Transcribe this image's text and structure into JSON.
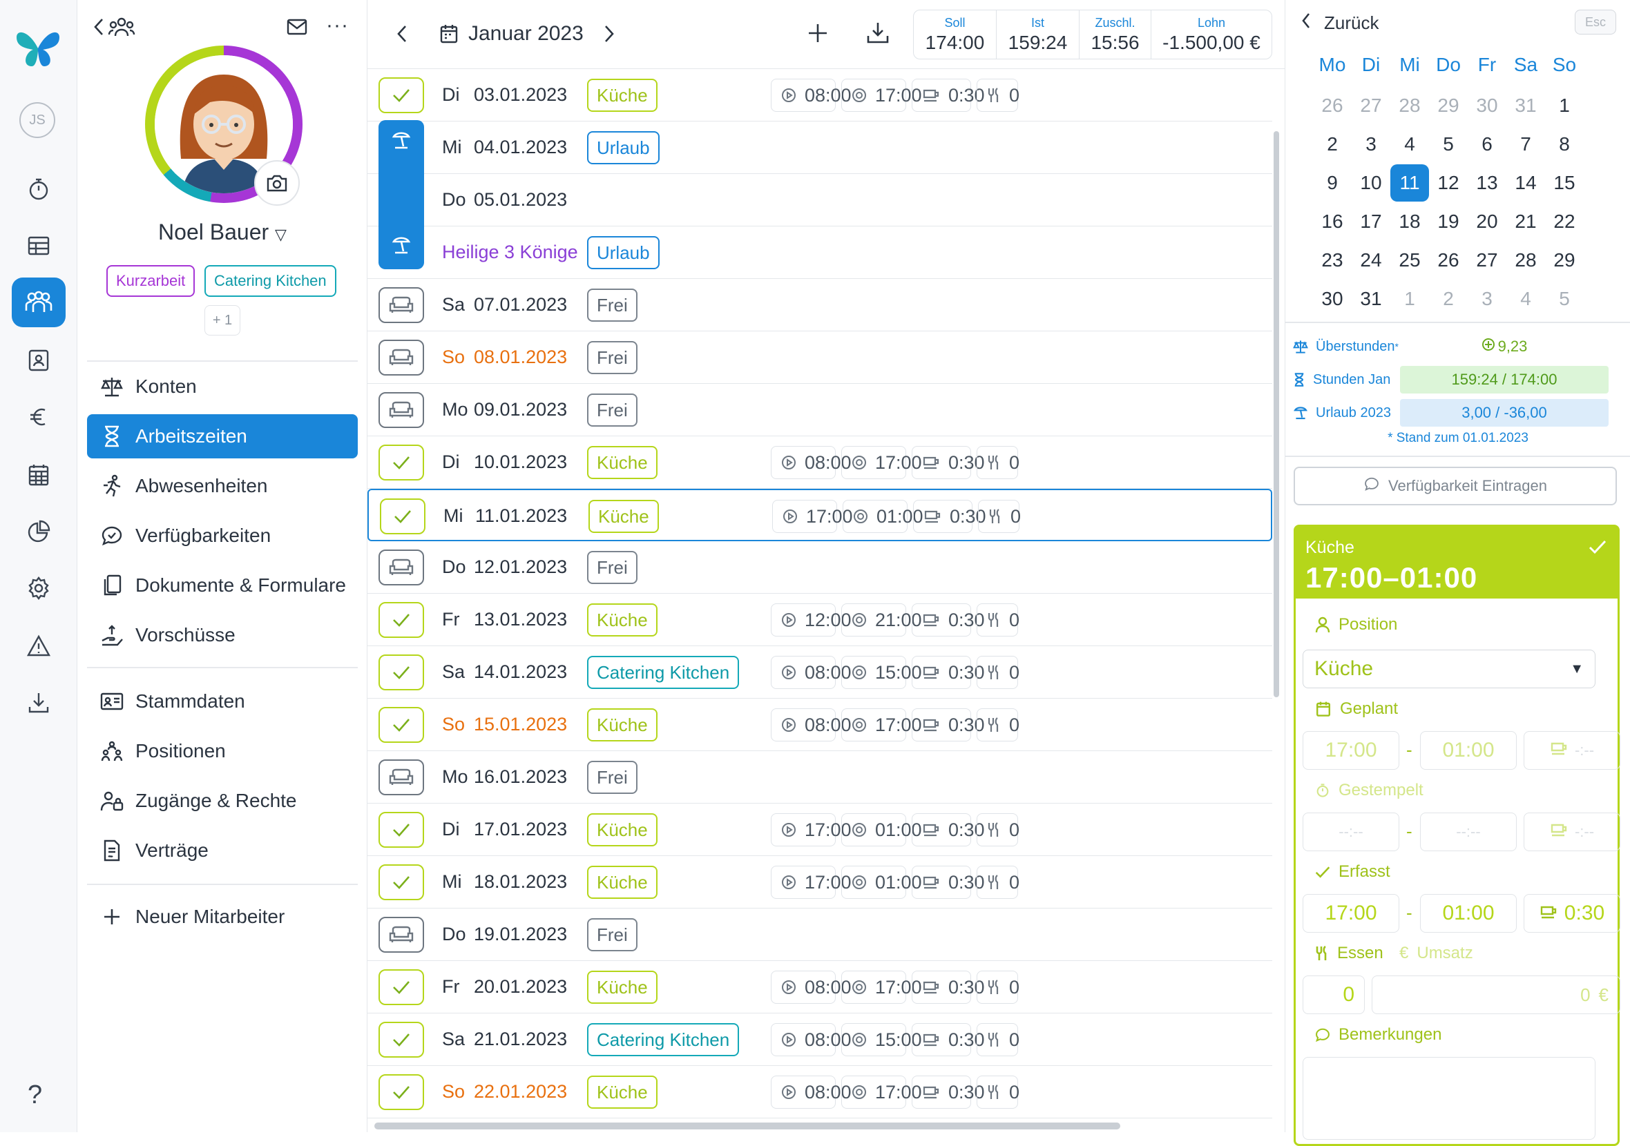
{
  "nav": {
    "help": "?",
    "user_initials": "JS"
  },
  "profile": {
    "name": "Noel Bauer",
    "tags": [
      "Kurzarbeit",
      "Catering Kitchen"
    ],
    "more_tags": "+ 1",
    "menu": [
      "Konten",
      "Arbeitszeiten",
      "Abwesenheiten",
      "Verfügbarkeiten",
      "Dokumente & Formulare",
      "Vorschüsse",
      "Stammdaten",
      "Positionen",
      "Zugänge & Rechte",
      "Verträge"
    ],
    "new_employee": "Neuer Mitarbeiter"
  },
  "header": {
    "month": "Januar 2023",
    "stats": [
      {
        "label": "Soll",
        "value": "174:00"
      },
      {
        "label": "Ist",
        "value": "159:24"
      },
      {
        "label": "Zuschl.",
        "value": "15:56"
      },
      {
        "label": "Lohn",
        "value": "-1.500,00 €"
      }
    ]
  },
  "rows": [
    {
      "day": "Di",
      "date": "03.01.2023",
      "status": "ok",
      "badge": "Küche",
      "start": "08:00",
      "end": "17:00",
      "pause": "0:30",
      "meals": "0"
    },
    {
      "day": "Mi",
      "date": "04.01.2023",
      "status": "vac",
      "badge": "Urlaub"
    },
    {
      "day": "Do",
      "date": "05.01.2023",
      "status": "vac"
    },
    {
      "day": "",
      "date": "Heilige 3 Könige",
      "status": "vac",
      "badge": "Urlaub",
      "holiday": true
    },
    {
      "day": "Sa",
      "date": "07.01.2023",
      "status": "off",
      "badge": "Frei"
    },
    {
      "day": "So",
      "date": "08.01.2023",
      "status": "off",
      "badge": "Frei",
      "sunday": true
    },
    {
      "day": "Mo",
      "date": "09.01.2023",
      "status": "off",
      "badge": "Frei"
    },
    {
      "day": "Di",
      "date": "10.01.2023",
      "status": "ok",
      "badge": "Küche",
      "start": "08:00",
      "end": "17:00",
      "pause": "0:30",
      "meals": "0"
    },
    {
      "day": "Mi",
      "date": "11.01.2023",
      "status": "ok",
      "badge": "Küche",
      "start": "17:00",
      "end": "01:00",
      "pause": "0:30",
      "meals": "0",
      "selected": true
    },
    {
      "day": "Do",
      "date": "12.01.2023",
      "status": "off",
      "badge": "Frei"
    },
    {
      "day": "Fr",
      "date": "13.01.2023",
      "status": "ok",
      "badge": "Küche",
      "start": "12:00",
      "end": "21:00",
      "pause": "0:30",
      "meals": "0"
    },
    {
      "day": "Sa",
      "date": "14.01.2023",
      "status": "ok",
      "badge": "Catering Kitchen",
      "start": "08:00",
      "end": "15:00",
      "pause": "0:30",
      "meals": "0"
    },
    {
      "day": "So",
      "date": "15.01.2023",
      "status": "ok",
      "badge": "Küche",
      "start": "08:00",
      "end": "17:00",
      "pause": "0:30",
      "meals": "0",
      "sunday": true
    },
    {
      "day": "Mo",
      "date": "16.01.2023",
      "status": "off",
      "badge": "Frei"
    },
    {
      "day": "Di",
      "date": "17.01.2023",
      "status": "ok",
      "badge": "Küche",
      "start": "17:00",
      "end": "01:00",
      "pause": "0:30",
      "meals": "0"
    },
    {
      "day": "Mi",
      "date": "18.01.2023",
      "status": "ok",
      "badge": "Küche",
      "start": "17:00",
      "end": "01:00",
      "pause": "0:30",
      "meals": "0"
    },
    {
      "day": "Do",
      "date": "19.01.2023",
      "status": "off",
      "badge": "Frei"
    },
    {
      "day": "Fr",
      "date": "20.01.2023",
      "status": "ok",
      "badge": "Küche",
      "start": "08:00",
      "end": "17:00",
      "pause": "0:30",
      "meals": "0"
    },
    {
      "day": "Sa",
      "date": "21.01.2023",
      "status": "ok",
      "badge": "Catering Kitchen",
      "start": "08:00",
      "end": "15:00",
      "pause": "0:30",
      "meals": "0"
    },
    {
      "day": "So",
      "date": "22.01.2023",
      "status": "ok",
      "badge": "Küche",
      "start": "08:00",
      "end": "17:00",
      "pause": "0:30",
      "meals": "0",
      "sunday": true
    }
  ],
  "right": {
    "back": "Zurück",
    "esc": "Esc",
    "calendar": {
      "headers": [
        "Mo",
        "Di",
        "Mi",
        "Do",
        "Fr",
        "Sa",
        "So"
      ],
      "days": [
        "26",
        "27",
        "28",
        "29",
        "30",
        "31",
        "1",
        "2",
        "3",
        "4",
        "5",
        "6",
        "7",
        "8",
        "9",
        "10",
        "11",
        "12",
        "13",
        "14",
        "15",
        "16",
        "17",
        "18",
        "19",
        "20",
        "21",
        "22",
        "23",
        "24",
        "25",
        "26",
        "27",
        "28",
        "29",
        "30",
        "31",
        "1",
        "2",
        "3",
        "4",
        "5"
      ],
      "dim": [
        0,
        1,
        2,
        3,
        4,
        5,
        37,
        38,
        39,
        40,
        41
      ],
      "selected": 16
    },
    "summary": [
      {
        "label": "Überstunden",
        "sup": "*",
        "value": "9,23"
      },
      {
        "label": "Stunden Jan",
        "value": "159:24 / 174:00"
      },
      {
        "label": "Urlaub 2023",
        "value": "3,00 / -36,00"
      }
    ],
    "stand": "* Stand zum 01.01.2023",
    "availability_button": "Verfügbarkeit Eintragen",
    "shift": {
      "position": "Küche",
      "time": "17:00–01:00",
      "position_label": "Position",
      "position_value": "Küche",
      "geplant_label": "Geplant",
      "geplant_start": "17:00",
      "geplant_end": "01:00",
      "geplant_pause": "-:--",
      "gestempelt_label": "Gestempelt",
      "gestempelt_start": "--:--",
      "gestempelt_end": "--:--",
      "gestempelt_pause": "-:--",
      "erfasst_label": "Erfasst",
      "erfasst_start": "17:00",
      "erfasst_end": "01:00",
      "erfasst_pause": "0:30",
      "essen_label": "Essen",
      "umsatz_label": "Umsatz",
      "essen_value": "0",
      "umsatz_value": "0",
      "umsatz_unit": "€",
      "remarks_label": "Bemerkungen"
    }
  },
  "colors": {
    "accent": "#1a86d9",
    "green": "#b5d61a",
    "teal": "#14a9b8",
    "purple": "#a636d6",
    "orange": "#e8700f"
  }
}
